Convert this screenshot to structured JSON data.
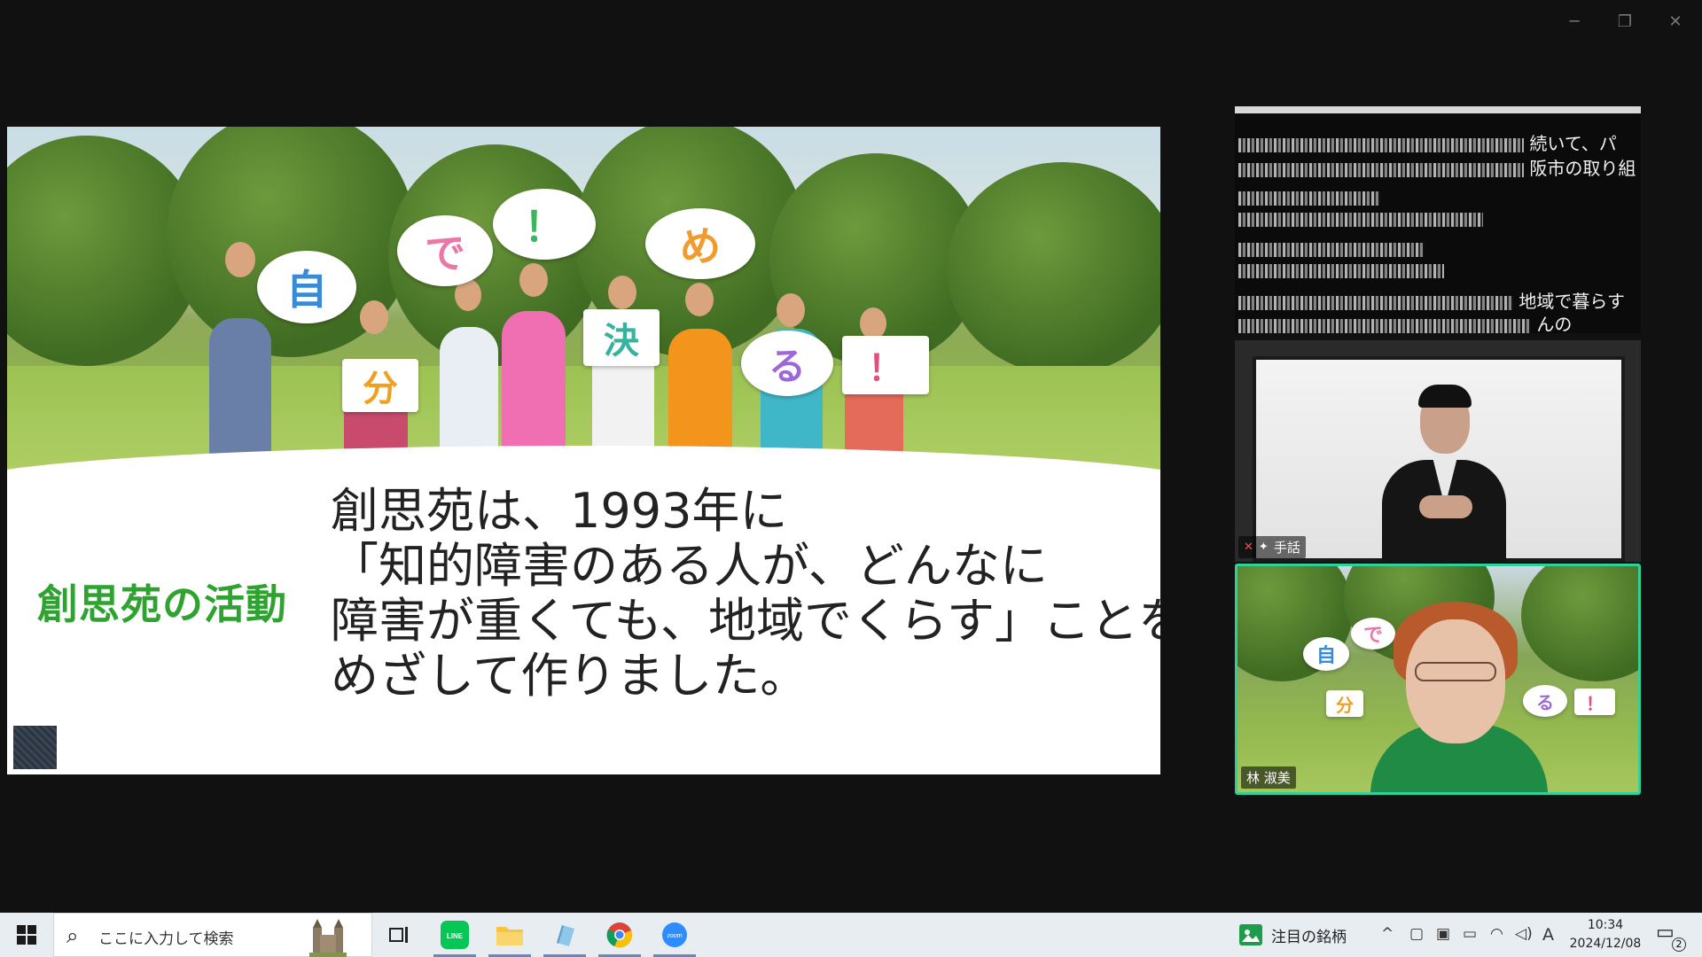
{
  "window": {
    "minimize_glyph": "─",
    "restore_glyph": "❐",
    "close_glyph": "✕"
  },
  "slide": {
    "bubbles": [
      "自",
      "で",
      "！",
      "め",
      "分",
      "決",
      "る",
      "！"
    ],
    "activity_title": "創思苑の活動",
    "body_lines": [
      "創思苑は、1993年に",
      "「知的障害のある人が、どんなに",
      "障害が重くても、地域でくらす」ことを",
      "めざして作りました。"
    ]
  },
  "caption_window": {
    "line1_visible": "続いて、パ",
    "line2_visible": "阪市の取り組",
    "line6_visible": "地域で暮らす",
    "line7_visible": "んの"
  },
  "participants": {
    "interpreter": {
      "label": "手話",
      "mic_icon": "mic-muted-icon",
      "pin_icon": "pin-icon"
    },
    "speaker": {
      "name": "林 淑美"
    }
  },
  "taskbar": {
    "search_placeholder": "ここに入力して検索",
    "apps": [
      "task-view",
      "LINE",
      "file-explorer",
      "app",
      "chrome",
      "zoom"
    ],
    "news": "注目の銘柄",
    "time": "10:34",
    "date": "2024/12/08",
    "ime": "A",
    "notification_count": "2"
  },
  "colors": {
    "activity_title": "#2ea32f",
    "active_speaker_border": "#2fd19a",
    "background": "#111111"
  }
}
